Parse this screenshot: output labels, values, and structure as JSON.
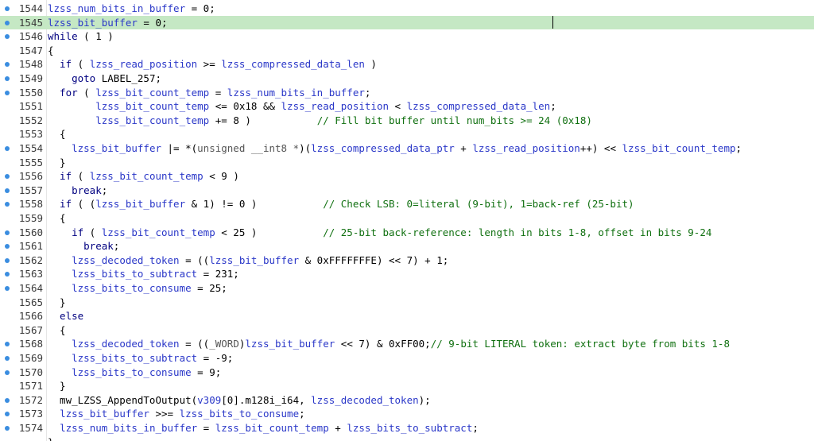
{
  "editor": {
    "current_line": 1545,
    "colors": {
      "variable": "#2a37c8",
      "keyword": "#000080",
      "comment": "#107010",
      "type": "#555555",
      "plain": "#000000",
      "current_line_bg": "#c5e8c4",
      "breakpoint_dot": "#3a8de0"
    },
    "lines": [
      {
        "num": "1544",
        "dot": true,
        "tokens": [
          [
            "v",
            "lzss_num_bits_in_buffer"
          ],
          [
            "p",
            " = 0;"
          ]
        ]
      },
      {
        "num": "1545",
        "dot": true,
        "tokens": [
          [
            "v",
            "lzss_bit_buffer"
          ],
          [
            "p",
            " = 0;"
          ]
        ]
      },
      {
        "num": "1546",
        "dot": true,
        "tokens": [
          [
            "k",
            "while"
          ],
          [
            "p",
            " ( 1 )"
          ]
        ]
      },
      {
        "num": "1547",
        "dot": false,
        "tokens": [
          [
            "p",
            "{"
          ]
        ]
      },
      {
        "num": "1548",
        "dot": true,
        "tokens": [
          [
            "k",
            "  if"
          ],
          [
            "p",
            " ( "
          ],
          [
            "v",
            "lzss_read_position"
          ],
          [
            "p",
            " >= "
          ],
          [
            "v",
            "lzss_compressed_data_len"
          ],
          [
            "p",
            " )"
          ]
        ]
      },
      {
        "num": "1549",
        "dot": true,
        "tokens": [
          [
            "k",
            "    goto"
          ],
          [
            "p",
            " LABEL_257;"
          ]
        ]
      },
      {
        "num": "1550",
        "dot": true,
        "tokens": [
          [
            "k",
            "  for"
          ],
          [
            "p",
            " ( "
          ],
          [
            "v",
            "lzss_bit_count_temp"
          ],
          [
            "p",
            " = "
          ],
          [
            "v",
            "lzss_num_bits_in_buffer"
          ],
          [
            "p",
            ";"
          ]
        ]
      },
      {
        "num": "1551",
        "dot": false,
        "tokens": [
          [
            "p",
            "        "
          ],
          [
            "v",
            "lzss_bit_count_temp"
          ],
          [
            "p",
            " <= 0x18 && "
          ],
          [
            "v",
            "lzss_read_position"
          ],
          [
            "p",
            " < "
          ],
          [
            "v",
            "lzss_compressed_data_len"
          ],
          [
            "p",
            ";"
          ]
        ]
      },
      {
        "num": "1552",
        "dot": false,
        "tokens": [
          [
            "p",
            "        "
          ],
          [
            "v",
            "lzss_bit_count_temp"
          ],
          [
            "p",
            " += 8 )           "
          ],
          [
            "c",
            "// Fill bit buffer until num_bits >= 24 (0x18)"
          ]
        ]
      },
      {
        "num": "1553",
        "dot": false,
        "tokens": [
          [
            "p",
            "  {"
          ]
        ]
      },
      {
        "num": "1554",
        "dot": true,
        "tokens": [
          [
            "p",
            "    "
          ],
          [
            "v",
            "lzss_bit_buffer"
          ],
          [
            "p",
            " |= *("
          ],
          [
            "t",
            "unsigned __int8 *"
          ],
          [
            "p",
            ")("
          ],
          [
            "v",
            "lzss_compressed_data_ptr"
          ],
          [
            "p",
            " + "
          ],
          [
            "v",
            "lzss_read_position"
          ],
          [
            "p",
            "++) << "
          ],
          [
            "v",
            "lzss_bit_count_temp"
          ],
          [
            "p",
            ";"
          ]
        ]
      },
      {
        "num": "1555",
        "dot": false,
        "tokens": [
          [
            "p",
            "  }"
          ]
        ]
      },
      {
        "num": "1556",
        "dot": true,
        "tokens": [
          [
            "k",
            "  if"
          ],
          [
            "p",
            " ( "
          ],
          [
            "v",
            "lzss_bit_count_temp"
          ],
          [
            "p",
            " < 9 )"
          ]
        ]
      },
      {
        "num": "1557",
        "dot": true,
        "tokens": [
          [
            "k",
            "    break"
          ],
          [
            "p",
            ";"
          ]
        ]
      },
      {
        "num": "1558",
        "dot": true,
        "tokens": [
          [
            "k",
            "  if"
          ],
          [
            "p",
            " ( ("
          ],
          [
            "v",
            "lzss_bit_buffer"
          ],
          [
            "p",
            " & 1) != 0 )           "
          ],
          [
            "c",
            "// Check LSB: 0=literal (9-bit), 1=back-ref (25-bit)"
          ]
        ]
      },
      {
        "num": "1559",
        "dot": false,
        "tokens": [
          [
            "p",
            "  {"
          ]
        ]
      },
      {
        "num": "1560",
        "dot": true,
        "tokens": [
          [
            "k",
            "    if"
          ],
          [
            "p",
            " ( "
          ],
          [
            "v",
            "lzss_bit_count_temp"
          ],
          [
            "p",
            " < 25 )           "
          ],
          [
            "c",
            "// 25-bit back-reference: length in bits 1-8, offset in bits 9-24"
          ]
        ]
      },
      {
        "num": "1561",
        "dot": true,
        "tokens": [
          [
            "k",
            "      break"
          ],
          [
            "p",
            ";"
          ]
        ]
      },
      {
        "num": "1562",
        "dot": true,
        "tokens": [
          [
            "p",
            "    "
          ],
          [
            "v",
            "lzss_decoded_token"
          ],
          [
            "p",
            " = (("
          ],
          [
            "v",
            "lzss_bit_buffer"
          ],
          [
            "p",
            " & 0xFFFFFFFE) << 7) + 1;"
          ]
        ]
      },
      {
        "num": "1563",
        "dot": true,
        "tokens": [
          [
            "p",
            "    "
          ],
          [
            "v",
            "lzss_bits_to_subtract"
          ],
          [
            "p",
            " = 231;"
          ]
        ]
      },
      {
        "num": "1564",
        "dot": true,
        "tokens": [
          [
            "p",
            "    "
          ],
          [
            "v",
            "lzss_bits_to_consume"
          ],
          [
            "p",
            " = 25;"
          ]
        ]
      },
      {
        "num": "1565",
        "dot": false,
        "tokens": [
          [
            "p",
            "  }"
          ]
        ]
      },
      {
        "num": "1566",
        "dot": false,
        "tokens": [
          [
            "k",
            "  else"
          ]
        ]
      },
      {
        "num": "1567",
        "dot": false,
        "tokens": [
          [
            "p",
            "  {"
          ]
        ]
      },
      {
        "num": "1568",
        "dot": true,
        "tokens": [
          [
            "p",
            "    "
          ],
          [
            "v",
            "lzss_decoded_token"
          ],
          [
            "p",
            " = (("
          ],
          [
            "t",
            "_WORD"
          ],
          [
            "p",
            ")"
          ],
          [
            "v",
            "lzss_bit_buffer"
          ],
          [
            "p",
            " << 7) & 0xFF00;"
          ],
          [
            "c",
            "// 9-bit LITERAL token: extract byte from bits 1-8"
          ]
        ]
      },
      {
        "num": "1569",
        "dot": true,
        "tokens": [
          [
            "p",
            "    "
          ],
          [
            "v",
            "lzss_bits_to_subtract"
          ],
          [
            "p",
            " = -9;"
          ]
        ]
      },
      {
        "num": "1570",
        "dot": true,
        "tokens": [
          [
            "p",
            "    "
          ],
          [
            "v",
            "lzss_bits_to_consume"
          ],
          [
            "p",
            " = 9;"
          ]
        ]
      },
      {
        "num": "1571",
        "dot": false,
        "tokens": [
          [
            "p",
            "  }"
          ]
        ]
      },
      {
        "num": "1572",
        "dot": true,
        "tokens": [
          [
            "p",
            "  mw_LZSS_AppendToOutput("
          ],
          [
            "v",
            "v309"
          ],
          [
            "p",
            "[0].m128i_i64, "
          ],
          [
            "v",
            "lzss_decoded_token"
          ],
          [
            "p",
            ");"
          ]
        ]
      },
      {
        "num": "1573",
        "dot": true,
        "tokens": [
          [
            "p",
            "  "
          ],
          [
            "v",
            "lzss_bit_buffer"
          ],
          [
            "p",
            " >>= "
          ],
          [
            "v",
            "lzss_bits_to_consume"
          ],
          [
            "p",
            ";"
          ]
        ]
      },
      {
        "num": "1574",
        "dot": true,
        "tokens": [
          [
            "p",
            "  "
          ],
          [
            "v",
            "lzss_num_bits_in_buffer"
          ],
          [
            "p",
            " = "
          ],
          [
            "v",
            "lzss_bit_count_temp"
          ],
          [
            "p",
            " + "
          ],
          [
            "v",
            "lzss_bits_to_subtract"
          ],
          [
            "p",
            ";"
          ]
        ]
      },
      {
        "num": "",
        "dot": false,
        "tokens": [
          [
            "p",
            "}"
          ]
        ]
      }
    ]
  }
}
